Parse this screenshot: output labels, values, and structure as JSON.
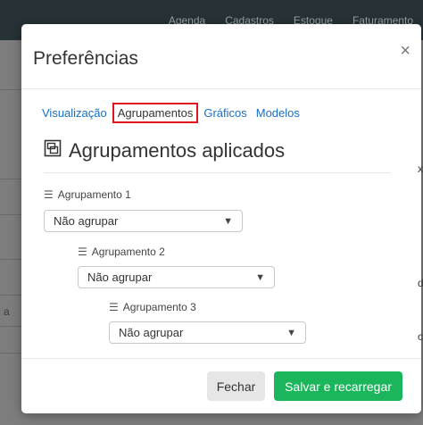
{
  "background_nav": [
    "Agenda",
    "Cadastros",
    "Estoque",
    "Faturamento"
  ],
  "background_fragments": [
    "xo",
    "d",
    "a",
    "ce"
  ],
  "modal": {
    "title": "Preferências",
    "close_symbol": "×",
    "tabs": [
      {
        "label": "Visualização",
        "active": false
      },
      {
        "label": "Agrupamentos",
        "active": true
      },
      {
        "label": "Gráficos",
        "active": false
      },
      {
        "label": "Modelos",
        "active": false
      }
    ],
    "section_title": "Agrupamentos aplicados",
    "section_icon": "layers-icon",
    "groups": [
      {
        "label": "Agrupamento 1",
        "value": "Não agrupar"
      },
      {
        "label": "Agrupamento 2",
        "value": "Não agrupar"
      },
      {
        "label": "Agrupamento 3",
        "value": "Não agrupar"
      }
    ],
    "buttons": {
      "close_label": "Fechar",
      "save_label": "Salvar e recarregar"
    }
  },
  "colors": {
    "topbar": "#263235",
    "tab_link": "#1a6fc4",
    "tab_highlight_border": "#e0141e",
    "save_button": "#1bb55c"
  }
}
